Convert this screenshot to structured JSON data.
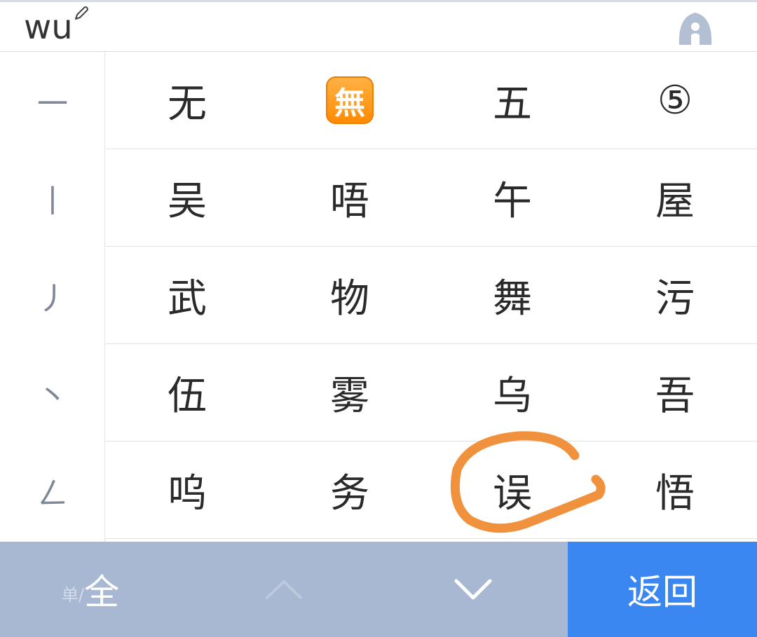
{
  "header": {
    "pinyin": "wu",
    "edit_icon": "pencil-icon",
    "assistant_icon": "ai-assistant-icon"
  },
  "strokes": [
    "一",
    "丨",
    "丿",
    "丶",
    "ㄥ"
  ],
  "candidates": [
    [
      "无",
      "無",
      "五",
      "⑤"
    ],
    [
      "吴",
      "唔",
      "午",
      "屋"
    ],
    [
      "武",
      "物",
      "舞",
      "污"
    ],
    [
      "伍",
      "雾",
      "乌",
      "吾"
    ],
    [
      "呜",
      "务",
      "误",
      "悟"
    ]
  ],
  "emoji_candidate": {
    "char": "無",
    "style": "orange-emoji-tile"
  },
  "annotation": {
    "target": "误",
    "color": "#f0913e"
  },
  "toolbar": {
    "toggle_small": "单/",
    "toggle_large": "全",
    "up_icon": "chevron-up-icon",
    "down_icon": "chevron-down-icon",
    "return_label": "返回"
  },
  "colors": {
    "toolbar_bg": "#a8b8d2",
    "return_bg": "#3a87f1",
    "stroke_text": "#7f8896",
    "candidate_text": "#2a2a2a"
  }
}
